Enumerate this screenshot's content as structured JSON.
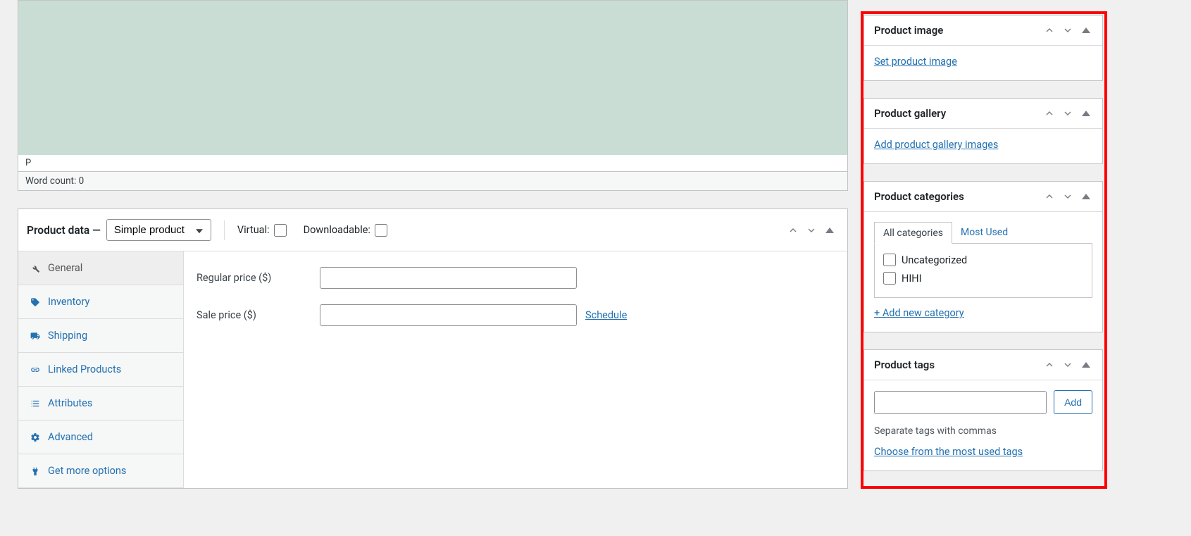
{
  "editor": {
    "path": "P",
    "word_count_label": "Word count: 0"
  },
  "product_data": {
    "title": "Product data —",
    "type_options": [
      "Simple product"
    ],
    "virtual_label": "Virtual:",
    "downloadable_label": "Downloadable:",
    "tabs": {
      "general": "General",
      "inventory": "Inventory",
      "shipping": "Shipping",
      "linked": "Linked Products",
      "attributes": "Attributes",
      "advanced": "Advanced",
      "more": "Get more options"
    },
    "fields": {
      "regular_price_label": "Regular price ($)",
      "sale_price_label": "Sale price ($)",
      "schedule_link": "Schedule"
    }
  },
  "sidebar": {
    "product_image": {
      "title": "Product image",
      "link": "Set product image"
    },
    "product_gallery": {
      "title": "Product gallery",
      "link": "Add product gallery images"
    },
    "product_categories": {
      "title": "Product categories",
      "tab_all": "All categories",
      "tab_most_used": "Most Used",
      "items": [
        "Uncategorized",
        "HIHI"
      ],
      "add_link": "+ Add new category"
    },
    "product_tags": {
      "title": "Product tags",
      "add_btn": "Add",
      "hint": "Separate tags with commas",
      "choose_link": "Choose from the most used tags"
    }
  }
}
